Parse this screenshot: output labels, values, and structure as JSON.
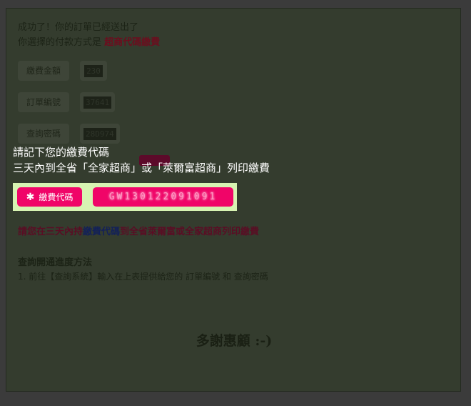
{
  "header": {
    "success_message": "成功了！你的訂單已經送出了",
    "payment_method_prefix": "你選擇的付款方式是 ",
    "payment_method": "超商代碼繳費"
  },
  "order_info": [
    {
      "label": "繳費金額",
      "value": "230"
    },
    {
      "label": "訂單編號",
      "value": "37641"
    },
    {
      "label": "查詢密碼",
      "value": "28D974"
    }
  ],
  "notice": {
    "line1": "請記下您的繳費代碼",
    "line2": "三天內到全省「全家超商」或「萊爾富超商」列印繳費"
  },
  "payment_code": {
    "button_label": "繳費代碼",
    "value": "GW130122091091"
  },
  "instructions": {
    "part1": "請您在三天內持",
    "highlight": "繳費代碼",
    "part2": "到全省萊爾富或全家超商列印繳費"
  },
  "progress": {
    "title": "查詢開通進度方法",
    "step1": "1. 前往【查詢系統】輸入在上表提供給您的 訂單編號 和 查詢密碼"
  },
  "footer": {
    "thanks": "多謝惠顧 :-)"
  }
}
